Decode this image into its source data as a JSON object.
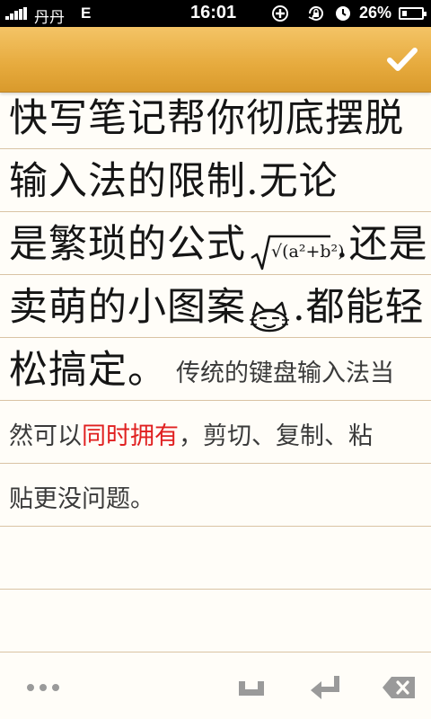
{
  "status_bar": {
    "carrier": "丹丹",
    "network": "E",
    "time": "16:01",
    "battery_percent": "26%",
    "battery_level": 0.26,
    "icons": [
      "add-circle-icon",
      "rotation-lock-icon",
      "clock-icon"
    ]
  },
  "header": {
    "done_icon": "checkmark-icon"
  },
  "note": {
    "handwritten_lines": [
      "快写笔记帮你彻底摆脱",
      "输入法的限制.无论",
      "是繁琐的公式",
      ".还是",
      "卖萌的小图案",
      ".都能轻",
      "松搞定。"
    ],
    "formula_text": "√(a²+b²)",
    "typed_line5": "传统的键盘输入法当",
    "typed_line6_a": "然可以",
    "typed_line6_red": "同时拥有",
    "typed_line6_b": "，剪切、复制、粘",
    "typed_line7": "贴更没问题。"
  },
  "colors": {
    "header_gold": "#e6aa3d",
    "paper": "#fffdf8",
    "rule": "#d9c3a4",
    "ink": "#151515",
    "typed": "#3a3a3a",
    "highlight_red": "#e02020"
  },
  "toolbar": {
    "icons": [
      "more-dots-icon",
      "space-icon",
      "enter-icon",
      "backspace-icon"
    ]
  }
}
